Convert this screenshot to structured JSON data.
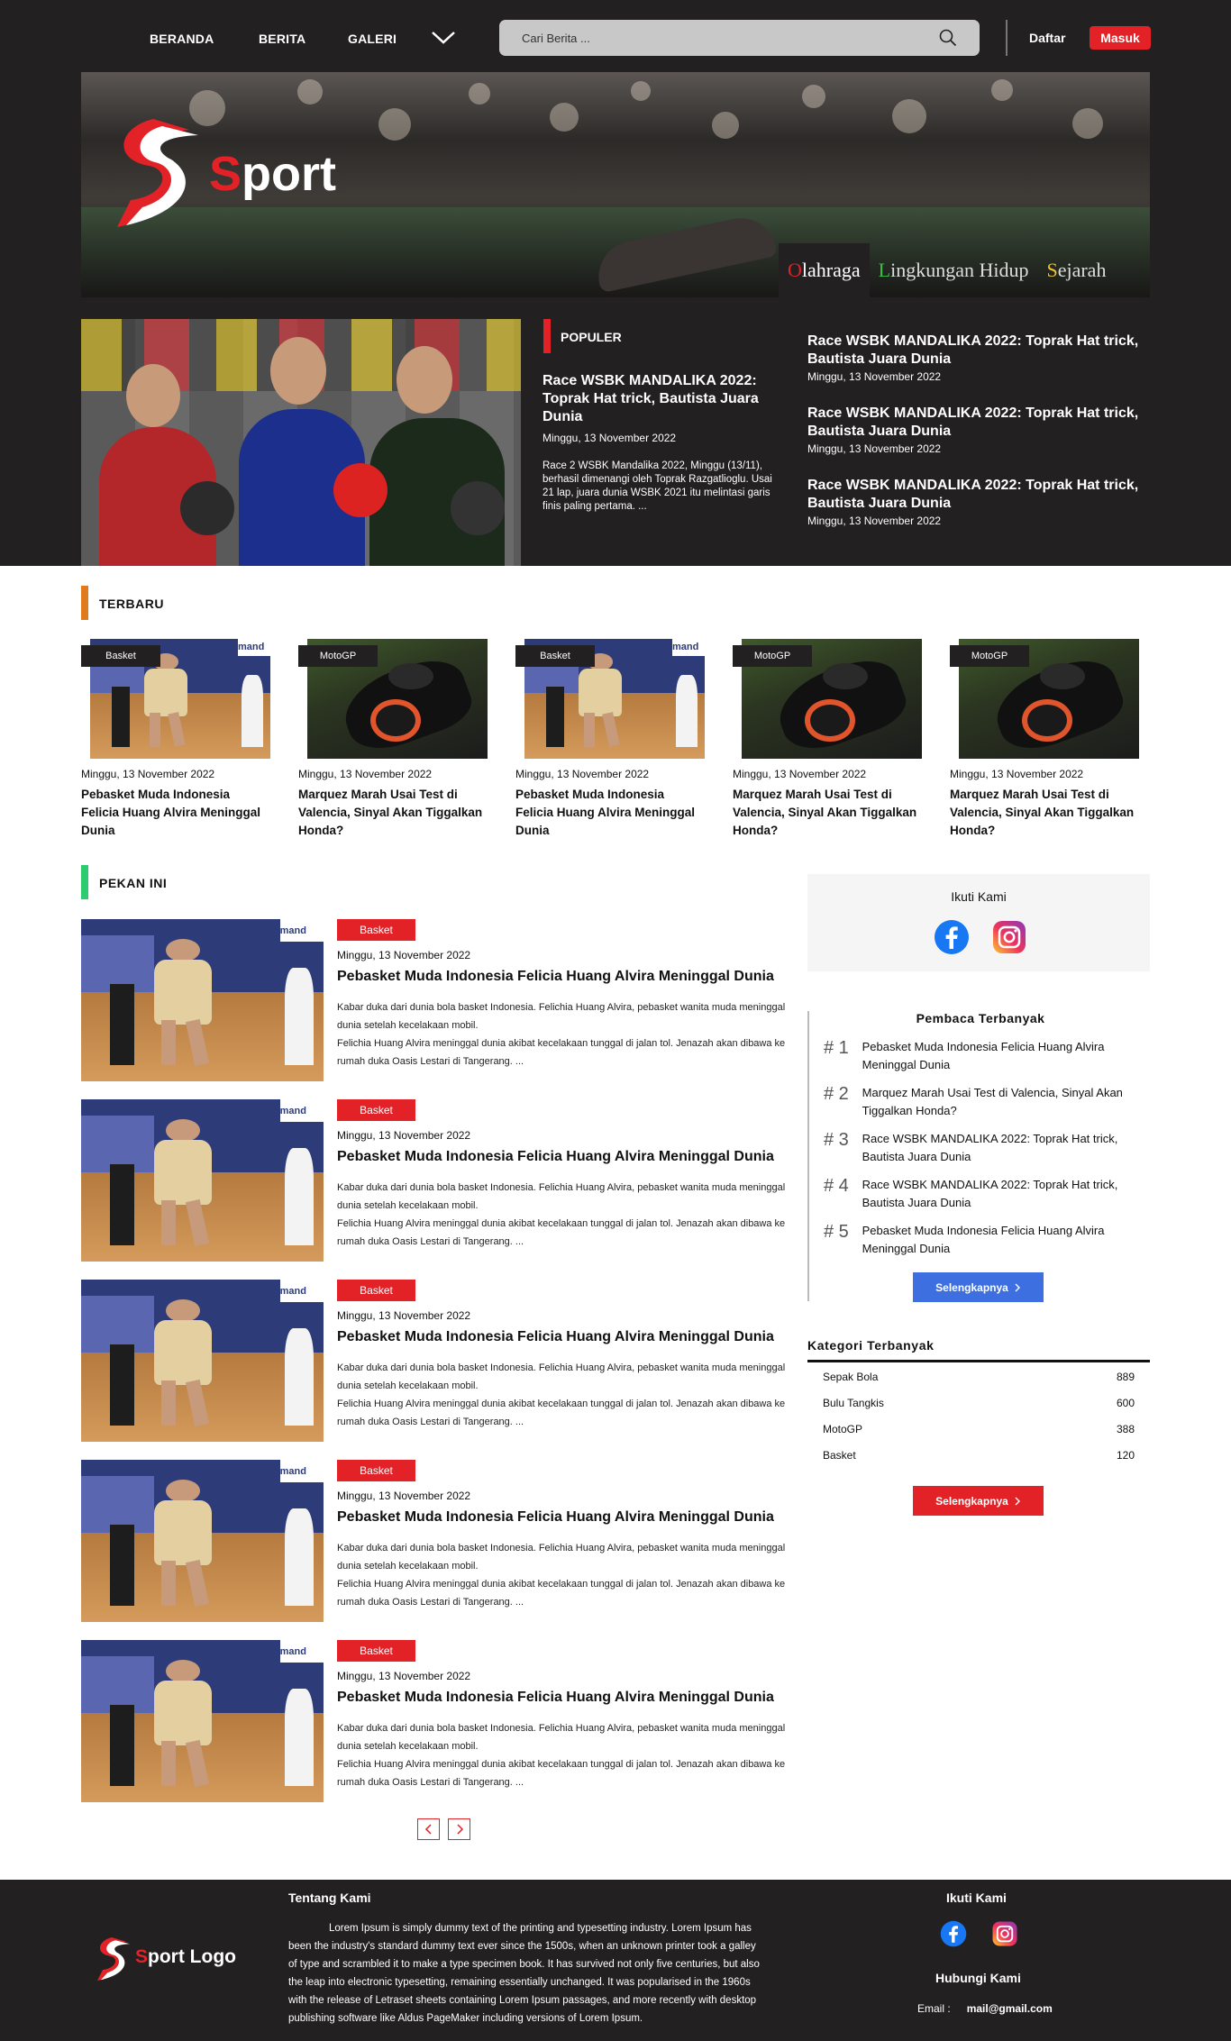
{
  "nav": {
    "items": [
      "BERANDA",
      "BERITA",
      "GALERI"
    ],
    "search_placeholder": "Cari Berita ...",
    "register": "Daftar",
    "login": "Masuk"
  },
  "hero": {
    "logo_initial": "S",
    "logo_text": "port",
    "tabs": [
      {
        "initial": "O",
        "rest": "lahraga",
        "initial_color": "#e32227"
      },
      {
        "initial": "L",
        "rest": "ingkungan Hidup",
        "initial_color": "#3fbf4a"
      },
      {
        "initial": "S",
        "rest": "ejarah",
        "initial_color": "#f2c12e"
      }
    ]
  },
  "popular": {
    "label": "POPULER",
    "title": "Race WSBK MANDALIKA 2022: Toprak Hat trick, Bautista Juara Dunia",
    "date": "Minggu, 13 November 2022",
    "desc": "Race 2 WSBK Mandalika 2022, Minggu (13/11), berhasil dimenangi oleh Toprak Razgatlioglu. Usai 21 lap, juara dunia WSBK 2021 itu melintasi garis finis paling pertama. ...",
    "side": [
      {
        "title": "Race WSBK MANDALIKA 2022: Toprak Hat trick, Bautista Juara Dunia",
        "date": "Minggu, 13 November 2022"
      },
      {
        "title": "Race WSBK MANDALIKA 2022: Toprak Hat trick, Bautista Juara Dunia",
        "date": "Minggu, 13 November 2022"
      },
      {
        "title": "Race WSBK MANDALIKA 2022: Toprak Hat trick, Bautista Juara Dunia",
        "date": "Minggu, 13 November 2022"
      }
    ]
  },
  "latest": {
    "label": "TERBARU",
    "accent": "#e07a1f",
    "cards": [
      {
        "category": "Basket",
        "date": "Minggu, 13 November 2022",
        "title": "Pebasket Muda Indonesia Felicia Huang Alvira Meninggal Dunia"
      },
      {
        "category": "MotoGP",
        "date": "Minggu, 13 November 2022",
        "title": "Marquez Marah Usai Test di Valencia, Sinyal Akan Tiggalkan Honda?"
      },
      {
        "category": "Basket",
        "date": "Minggu, 13 November 2022",
        "title": "Pebasket Muda Indonesia Felicia Huang Alvira Meninggal Dunia"
      },
      {
        "category": "MotoGP",
        "date": "Minggu, 13 November 2022",
        "title": "Marquez Marah Usai Test di Valencia, Sinyal Akan Tiggalkan Honda?"
      },
      {
        "category": "MotoGP",
        "date": "Minggu, 13 November 2022",
        "title": "Marquez Marah Usai Test di Valencia, Sinyal Akan Tiggalkan Honda?"
      }
    ]
  },
  "week": {
    "label": "PEKAN INI",
    "accent": "#2ecc71",
    "items": [
      {
        "category": "Basket",
        "date": "Minggu, 13 November 2022",
        "title": "Pebasket Muda Indonesia Felicia Huang Alvira Meninggal Dunia",
        "desc1": "Kabar duka dari dunia bola basket Indonesia. Felichia Huang Alvira, pebasket wanita muda meninggal dunia setelah kecelakaan mobil.",
        "desc2": "Felichia Huang Alvira meninggal dunia akibat kecelakaan tunggal di jalan tol. Jenazah akan dibawa ke rumah duka Oasis Lestari di Tangerang. ..."
      },
      {
        "category": "Basket",
        "date": "Minggu, 13 November 2022",
        "title": "Pebasket Muda Indonesia Felicia Huang Alvira Meninggal Dunia",
        "desc1": "Kabar duka dari dunia bola basket Indonesia. Felichia Huang Alvira, pebasket wanita muda meninggal dunia setelah kecelakaan mobil.",
        "desc2": "Felichia Huang Alvira meninggal dunia akibat kecelakaan tunggal di jalan tol. Jenazah akan dibawa ke rumah duka Oasis Lestari di Tangerang. ..."
      },
      {
        "category": "Basket",
        "date": "Minggu, 13 November 2022",
        "title": "Pebasket Muda Indonesia Felicia Huang Alvira Meninggal Dunia",
        "desc1": "Kabar duka dari dunia bola basket Indonesia. Felichia Huang Alvira, pebasket wanita muda meninggal dunia setelah kecelakaan mobil.",
        "desc2": "Felichia Huang Alvira meninggal dunia akibat kecelakaan tunggal di jalan tol. Jenazah akan dibawa ke rumah duka Oasis Lestari di Tangerang. ..."
      },
      {
        "category": "Basket",
        "date": "Minggu, 13 November 2022",
        "title": "Pebasket Muda Indonesia Felicia Huang Alvira Meninggal Dunia",
        "desc1": "Kabar duka dari dunia bola basket Indonesia. Felichia Huang Alvira, pebasket wanita muda meninggal dunia setelah kecelakaan mobil.",
        "desc2": "Felichia Huang Alvira meninggal dunia akibat kecelakaan tunggal di jalan tol. Jenazah akan dibawa ke rumah duka Oasis Lestari di Tangerang. ..."
      },
      {
        "category": "Basket",
        "date": "Minggu, 13 November 2022",
        "title": "Pebasket Muda Indonesia Felicia Huang Alvira Meninggal Dunia",
        "desc1": "Kabar duka dari dunia bola basket Indonesia. Felichia Huang Alvira, pebasket wanita muda meninggal dunia setelah kecelakaan mobil.",
        "desc2": "Felichia Huang Alvira meninggal dunia akibat kecelakaan tunggal di jalan tol. Jenazah akan dibawa ke rumah duka Oasis Lestari di Tangerang. ..."
      }
    ]
  },
  "sidebar": {
    "follow_label": "Ikuti Kami",
    "readers_label": "Pembaca Terbanyak",
    "readers": [
      {
        "rank": "# 1",
        "title": "Pebasket Muda Indonesia Felicia Huang Alvira Meninggal Dunia"
      },
      {
        "rank": "# 2",
        "title": "Marquez Marah Usai Test di Valencia, Sinyal Akan Tiggalkan Honda?"
      },
      {
        "rank": "# 3",
        "title": "Race WSBK MANDALIKA 2022: Toprak Hat trick, Bautista Juara Dunia"
      },
      {
        "rank": "# 4",
        "title": "Race WSBK MANDALIKA 2022: Toprak Hat trick, Bautista Juara Dunia"
      },
      {
        "rank": "# 5",
        "title": "Pebasket Muda Indonesia Felicia Huang Alvira Meninggal Dunia"
      }
    ],
    "more_label": "Selengkapnya",
    "more_color_blue": "#3d6fe0",
    "more_color_red": "#e32227",
    "category_label": "Kategori Terbanyak",
    "categories": [
      {
        "name": "Sepak Bola",
        "count": "889"
      },
      {
        "name": "Bulu Tangkis",
        "count": "600"
      },
      {
        "name": "MotoGP",
        "count": "388"
      },
      {
        "name": "Basket",
        "count": "120"
      }
    ]
  },
  "pagination": {
    "prev_icon": "chevron-left-icon",
    "next_icon": "chevron-right-icon"
  },
  "footer": {
    "logo_initial": "S",
    "logo_text": "port Logo",
    "about_label": "Tentang Kami",
    "about_text": "Lorem Ipsum is simply dummy text of the printing and typesetting industry. Lorem Ipsum has been the industry's standard dummy text ever since the 1500s, when an unknown printer took a galley of type and scrambled it to make a type specimen book. It has survived not only five centuries, but also the leap into electronic typesetting, remaining essentially unchanged. It was popularised in the 1960s with the release of Letraset sheets containing Lorem Ipsum passages, and more recently with desktop publishing software like Aldus PageMaker including versions of Lorem Ipsum.",
    "follow_label": "Ikuti Kami",
    "contact_label": "Hubungi Kami",
    "email_label": "Email :",
    "email_value": "mail@gmail.com"
  }
}
